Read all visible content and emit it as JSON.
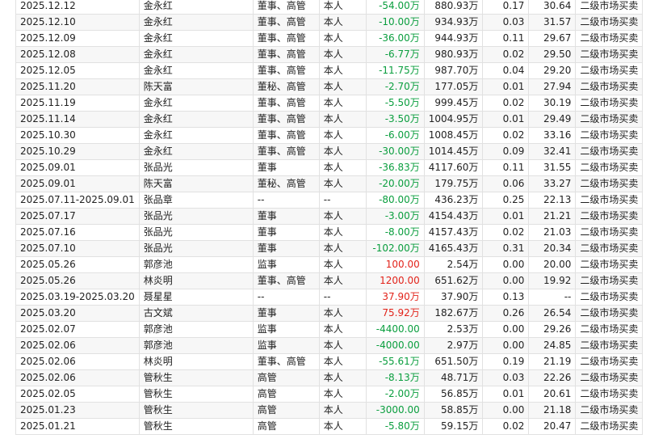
{
  "colors": {
    "negative": "#0a9e3e",
    "positive": "#e2231a"
  },
  "rows": [
    {
      "date": "2025.12.12",
      "name": "金永红",
      "position": "董事、高管",
      "relation": "本人",
      "change": "-54.00万",
      "dir": "neg",
      "after": "880.93万",
      "pct": "0.17",
      "price": "30.64",
      "type": "二级市场买卖"
    },
    {
      "date": "2025.12.10",
      "name": "金永红",
      "position": "董事、高管",
      "relation": "本人",
      "change": "-10.00万",
      "dir": "neg",
      "after": "934.93万",
      "pct": "0.03",
      "price": "31.57",
      "type": "二级市场买卖"
    },
    {
      "date": "2025.12.09",
      "name": "金永红",
      "position": "董事、高管",
      "relation": "本人",
      "change": "-36.00万",
      "dir": "neg",
      "after": "944.93万",
      "pct": "0.11",
      "price": "29.67",
      "type": "二级市场买卖"
    },
    {
      "date": "2025.12.08",
      "name": "金永红",
      "position": "董事、高管",
      "relation": "本人",
      "change": "-6.77万",
      "dir": "neg",
      "after": "980.93万",
      "pct": "0.02",
      "price": "29.50",
      "type": "二级市场买卖"
    },
    {
      "date": "2025.12.05",
      "name": "金永红",
      "position": "董事、高管",
      "relation": "本人",
      "change": "-11.75万",
      "dir": "neg",
      "after": "987.70万",
      "pct": "0.04",
      "price": "29.20",
      "type": "二级市场买卖"
    },
    {
      "date": "2025.11.20",
      "name": "陈天富",
      "position": "董秘、高管",
      "relation": "本人",
      "change": "-2.70万",
      "dir": "neg",
      "after": "177.05万",
      "pct": "0.01",
      "price": "27.94",
      "type": "二级市场买卖"
    },
    {
      "date": "2025.11.19",
      "name": "金永红",
      "position": "董事、高管",
      "relation": "本人",
      "change": "-5.50万",
      "dir": "neg",
      "after": "999.45万",
      "pct": "0.02",
      "price": "30.19",
      "type": "二级市场买卖"
    },
    {
      "date": "2025.11.14",
      "name": "金永红",
      "position": "董事、高管",
      "relation": "本人",
      "change": "-3.50万",
      "dir": "neg",
      "after": "1004.95万",
      "pct": "0.01",
      "price": "29.49",
      "type": "二级市场买卖"
    },
    {
      "date": "2025.10.30",
      "name": "金永红",
      "position": "董事、高管",
      "relation": "本人",
      "change": "-6.00万",
      "dir": "neg",
      "after": "1008.45万",
      "pct": "0.02",
      "price": "33.16",
      "type": "二级市场买卖"
    },
    {
      "date": "2025.10.29",
      "name": "金永红",
      "position": "董事、高管",
      "relation": "本人",
      "change": "-30.00万",
      "dir": "neg",
      "after": "1014.45万",
      "pct": "0.09",
      "price": "32.41",
      "type": "二级市场买卖"
    },
    {
      "date": "2025.09.01",
      "name": "张品光",
      "position": "董事",
      "relation": "本人",
      "change": "-36.83万",
      "dir": "neg",
      "after": "4117.60万",
      "pct": "0.11",
      "price": "31.55",
      "type": "二级市场买卖"
    },
    {
      "date": "2025.09.01",
      "name": "陈天富",
      "position": "董秘、高管",
      "relation": "本人",
      "change": "-20.00万",
      "dir": "neg",
      "after": "179.75万",
      "pct": "0.06",
      "price": "33.27",
      "type": "二级市场买卖"
    },
    {
      "date": "2025.07.11-2025.09.01",
      "name": "张品章",
      "position": "--",
      "relation": "--",
      "change": "-80.00万",
      "dir": "neg",
      "after": "436.23万",
      "pct": "0.25",
      "price": "22.13",
      "type": "二级市场买卖"
    },
    {
      "date": "2025.07.17",
      "name": "张品光",
      "position": "董事",
      "relation": "本人",
      "change": "-3.00万",
      "dir": "neg",
      "after": "4154.43万",
      "pct": "0.01",
      "price": "21.21",
      "type": "二级市场买卖"
    },
    {
      "date": "2025.07.16",
      "name": "张品光",
      "position": "董事",
      "relation": "本人",
      "change": "-8.00万",
      "dir": "neg",
      "after": "4157.43万",
      "pct": "0.02",
      "price": "21.03",
      "type": "二级市场买卖"
    },
    {
      "date": "2025.07.10",
      "name": "张品光",
      "position": "董事",
      "relation": "本人",
      "change": "-102.00万",
      "dir": "neg",
      "after": "4165.43万",
      "pct": "0.31",
      "price": "20.34",
      "type": "二级市场买卖"
    },
    {
      "date": "2025.05.26",
      "name": "郭彦池",
      "position": "监事",
      "relation": "本人",
      "change": "100.00",
      "dir": "pos",
      "after": "2.54万",
      "pct": "0.00",
      "price": "20.00",
      "type": "二级市场买卖"
    },
    {
      "date": "2025.05.26",
      "name": "林炎明",
      "position": "董事、高管",
      "relation": "本人",
      "change": "1200.00",
      "dir": "pos",
      "after": "651.62万",
      "pct": "0.00",
      "price": "19.92",
      "type": "二级市场买卖"
    },
    {
      "date": "2025.03.19-2025.03.20",
      "name": "聂星星",
      "position": "--",
      "relation": "--",
      "change": "37.90万",
      "dir": "pos",
      "after": "37.90万",
      "pct": "0.13",
      "price": "--",
      "type": "二级市场买卖"
    },
    {
      "date": "2025.03.20",
      "name": "古文斌",
      "position": "董事",
      "relation": "本人",
      "change": "75.92万",
      "dir": "pos",
      "after": "182.67万",
      "pct": "0.26",
      "price": "26.54",
      "type": "二级市场买卖"
    },
    {
      "date": "2025.02.07",
      "name": "郭彦池",
      "position": "监事",
      "relation": "本人",
      "change": "-4400.00",
      "dir": "neg",
      "after": "2.53万",
      "pct": "0.00",
      "price": "29.26",
      "type": "二级市场买卖"
    },
    {
      "date": "2025.02.06",
      "name": "郭彦池",
      "position": "监事",
      "relation": "本人",
      "change": "-4000.00",
      "dir": "neg",
      "after": "2.97万",
      "pct": "0.00",
      "price": "24.85",
      "type": "二级市场买卖"
    },
    {
      "date": "2025.02.06",
      "name": "林炎明",
      "position": "董事、高管",
      "relation": "本人",
      "change": "-55.61万",
      "dir": "neg",
      "after": "651.50万",
      "pct": "0.19",
      "price": "21.19",
      "type": "二级市场买卖"
    },
    {
      "date": "2025.02.06",
      "name": "管秋生",
      "position": "高管",
      "relation": "本人",
      "change": "-8.13万",
      "dir": "neg",
      "after": "48.71万",
      "pct": "0.03",
      "price": "22.26",
      "type": "二级市场买卖"
    },
    {
      "date": "2025.02.05",
      "name": "管秋生",
      "position": "高管",
      "relation": "本人",
      "change": "-2.00万",
      "dir": "neg",
      "after": "56.85万",
      "pct": "0.01",
      "price": "20.61",
      "type": "二级市场买卖"
    },
    {
      "date": "2025.01.23",
      "name": "管秋生",
      "position": "高管",
      "relation": "本人",
      "change": "-3000.00",
      "dir": "neg",
      "after": "58.85万",
      "pct": "0.00",
      "price": "21.18",
      "type": "二级市场买卖"
    },
    {
      "date": "2025.01.21",
      "name": "管秋生",
      "position": "高管",
      "relation": "本人",
      "change": "-5.80万",
      "dir": "neg",
      "after": "59.15万",
      "pct": "0.02",
      "price": "20.47",
      "type": "二级市场买卖"
    }
  ]
}
